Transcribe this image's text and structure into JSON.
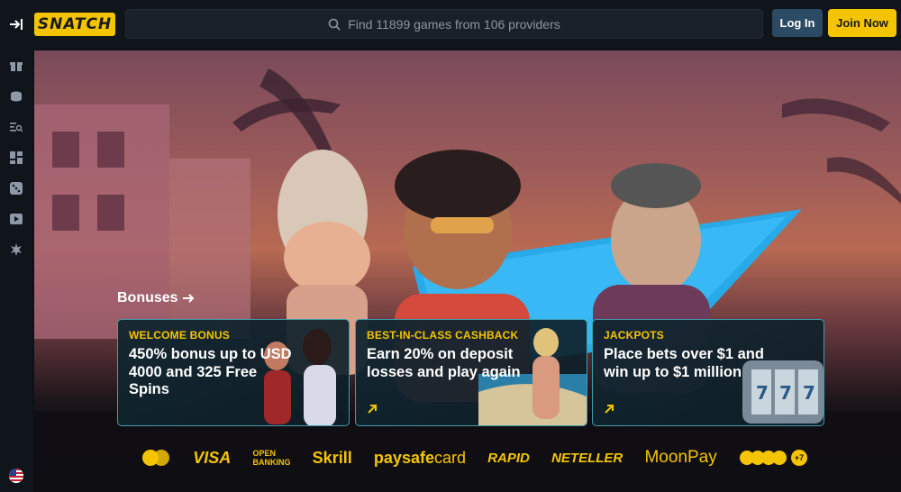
{
  "header": {
    "logo_text": "SNATCH",
    "search_placeholder": "Find 11899 games from 106 providers",
    "login_label": "Log In",
    "join_label": "Join Now"
  },
  "sidebar": {
    "icons": [
      "gift-icon",
      "coins-icon",
      "list-search-icon",
      "grid-icon",
      "dice-icon",
      "play-icon",
      "star-burst-icon"
    ],
    "language_flag": "us-flag-icon"
  },
  "bonuses": {
    "link_label": "Bonuses",
    "cards": [
      {
        "tag": "WELCOME BONUS",
        "text": "450% bonus up to USD 4000 and 325 Free Spins"
      },
      {
        "tag": "BEST-IN-CLASS CASHBACK",
        "text": "Earn 20% on deposit losses and play again"
      },
      {
        "tag": "JACKPOTS",
        "text": "Place bets over $1 and win up to $1 million"
      }
    ]
  },
  "payments": {
    "visa": "VISA",
    "open_banking_1": "OPEN",
    "open_banking_2": "BANKING",
    "skrill": "Skrill",
    "paysafe_bold": "paysafe",
    "paysafe_light": "card",
    "rapid": "RAPID",
    "neteller": "NETELLER",
    "moonpay": "MoonPay",
    "crypto_more": "+7"
  },
  "colors": {
    "accent": "#f5c400",
    "login_bg": "#2b4a63",
    "card_border": "#3e9fb0",
    "bg": "#0d1117"
  }
}
